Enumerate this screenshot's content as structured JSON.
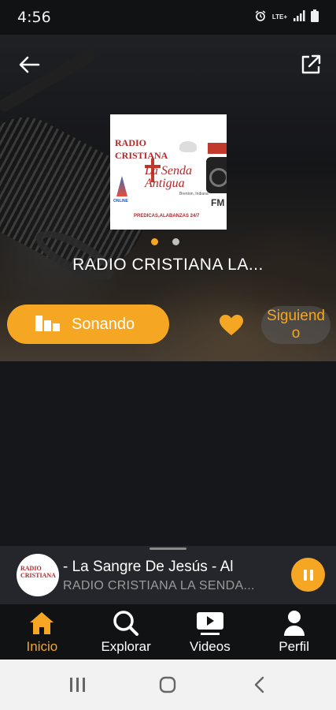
{
  "status_bar": {
    "time": "4:56",
    "lte_label": "LTE+"
  },
  "hero": {
    "logo": {
      "title_line1": "RADIO",
      "title_line2": "CRISTIANA",
      "script_line1": "La Senda",
      "script_line2": "Antigua",
      "subtitle": "Brenton, Indiana",
      "online_label": "ONLINE",
      "bottom_text": "PREDICAS,ALABANZAS 24/7",
      "fm_label": "FM"
    },
    "carousel": {
      "pages": 2,
      "active_index": 0
    },
    "station_title": "RADIO CRISTIANA  LA...",
    "play_button_label": "Sonando",
    "follow_button_label": "Siguiendo"
  },
  "mini_player": {
    "song_title": "- La Sangre De Jesús - Al",
    "station_name": "RADIO CRISTIANA  LA SENDA..."
  },
  "bottom_nav": {
    "items": [
      {
        "label": "Inicio",
        "icon": "home-icon",
        "active": true
      },
      {
        "label": "Explorar",
        "icon": "search-icon",
        "active": false
      },
      {
        "label": "Videos",
        "icon": "video-icon",
        "active": false
      },
      {
        "label": "Perfil",
        "icon": "profile-icon",
        "active": false
      }
    ]
  },
  "colors": {
    "accent": "#f5a623",
    "background": "#16171b",
    "mini_player_bg": "#25262b",
    "nav_bg": "#111214"
  }
}
